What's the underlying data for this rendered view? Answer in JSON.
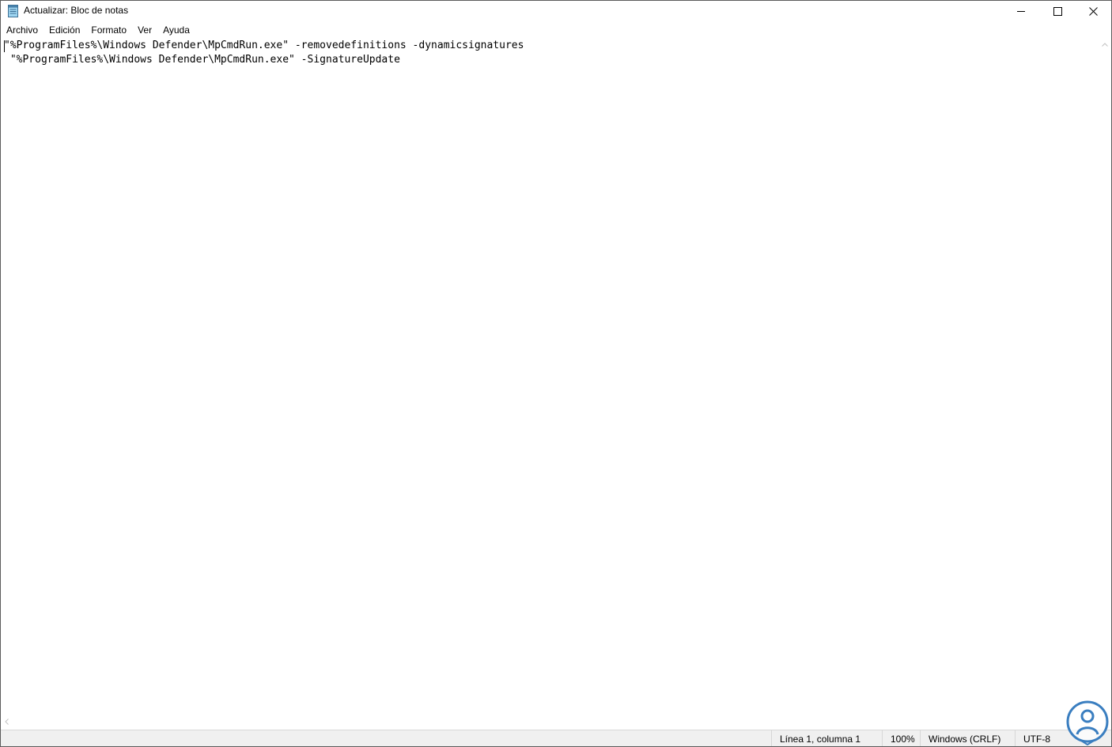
{
  "window": {
    "title": "Actualizar: Bloc de notas",
    "icon": "notepad-icon"
  },
  "caption": {
    "minimize_icon": "minimize-icon",
    "maximize_icon": "maximize-icon",
    "close_icon": "close-icon"
  },
  "menu": {
    "items": [
      {
        "label": "Archivo"
      },
      {
        "label": "Edición"
      },
      {
        "label": "Formato"
      },
      {
        "label": "Ver"
      },
      {
        "label": "Ayuda"
      }
    ]
  },
  "editor": {
    "lines": [
      "\"%ProgramFiles%\\Windows Defender\\MpCmdRun.exe\" -removedefinitions -dynamicsignatures",
      " \"%ProgramFiles%\\Windows Defender\\MpCmdRun.exe\" -SignatureUpdate"
    ]
  },
  "status": {
    "position": "Línea 1, columna 1",
    "zoom": "100%",
    "line_ending": "Windows (CRLF)",
    "encoding": "UTF-8"
  },
  "colors": {
    "watermark": "#3a7ec0",
    "status_bg": "#f0f0f0"
  }
}
